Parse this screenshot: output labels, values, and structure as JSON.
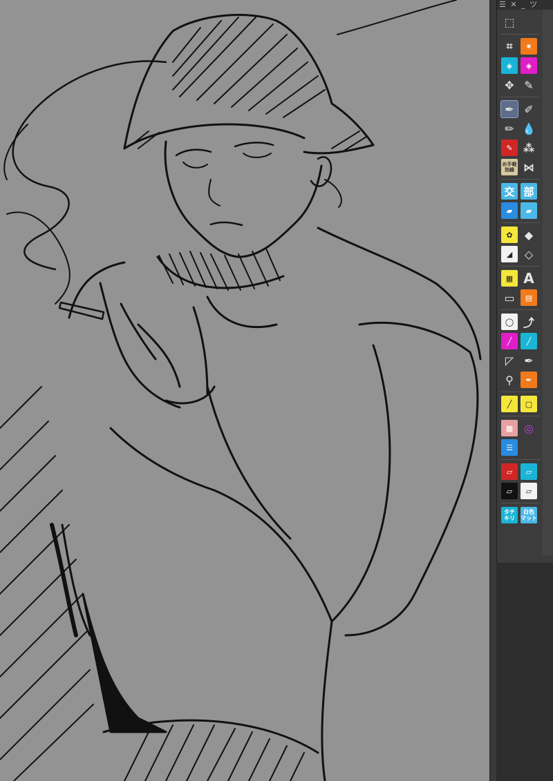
{
  "panel": {
    "header_icons": [
      "menu-icon",
      "close-icon",
      "minimize-icon"
    ],
    "header_text": "ツ"
  },
  "tools": {
    "kanji_koukan": "交",
    "kanji_bu": "部",
    "text_tool": "A",
    "omote_line": "お手軽\n効線",
    "tachikiri": "タチ\nキリ",
    "shiroiro_matto": "白色\nマット"
  },
  "colors": {
    "canvas_bg": "#939393",
    "panel_bg": "#3c3c3c",
    "selected_tool": "#5e6d8a",
    "line_art": "#111111"
  }
}
